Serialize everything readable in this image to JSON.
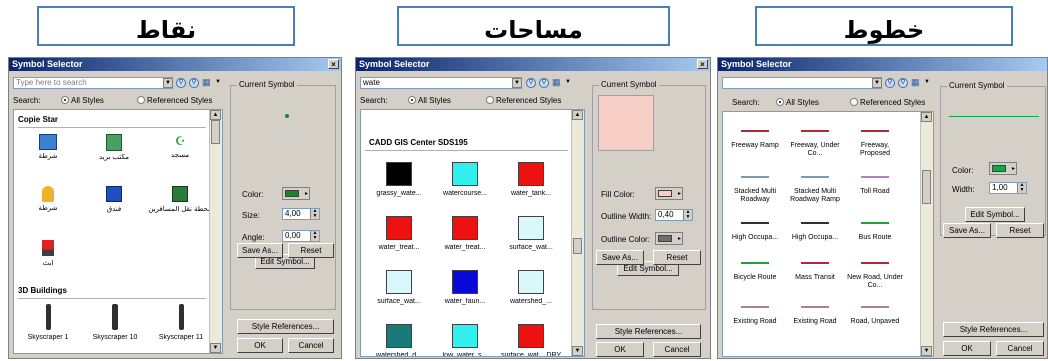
{
  "titles": {
    "points": "نقاط",
    "areas": "مساحات",
    "lines": "خطوط"
  },
  "common": {
    "window_title": "Symbol Selector",
    "close_glyph": "×",
    "search_label": "Search:",
    "all_styles": "All Styles",
    "referenced_styles": "Referenced Styles",
    "current_symbol": "Current Symbol",
    "edit_symbol": "Edit Symbol...",
    "save_as": "Save As...",
    "reset": "Reset",
    "style_references": "Style References...",
    "ok": "OK",
    "cancel": "Cancel",
    "dropdown_arrow": "▼",
    "scroll_up": "▲",
    "scroll_down": "▼"
  },
  "colors": {
    "point_color": "#128a1f",
    "line_color": "#10a64a",
    "fill_color": "#f7cfc6",
    "outline_color": "#6e6e6e",
    "titlebar": "#0a246a",
    "box_border": "#4a7ebb"
  },
  "points_dialog": {
    "search_placeholder": "Type here to search",
    "color_label": "Color:",
    "size_label": "Size:",
    "size_value": "4,00",
    "angle_label": "Angle:",
    "angle_value": "0,00",
    "category1": "Copie Star",
    "category2": "3D Buildings",
    "symbols": [
      {
        "label": "شرطة",
        "icon": "police-icon"
      },
      {
        "label": "مكتب بريد",
        "icon": "mailbox-icon"
      },
      {
        "label": "مسجد",
        "icon": "mosque-icon"
      },
      {
        "label": "شرطة",
        "icon": "police-figure-icon"
      },
      {
        "label": "فندق",
        "icon": "hotel-icon"
      },
      {
        "label": "محطة نقل المسافرين",
        "icon": "bus-station-icon"
      },
      {
        "label": "ابث",
        "icon": "broadcast-icon"
      }
    ],
    "buildings": [
      "Skyscraper 1",
      "Skyscraper 10",
      "Skyscraper 11"
    ]
  },
  "areas_dialog": {
    "search_value": "wate",
    "fill_color_label": "Fill Color:",
    "outline_width_label": "Outline Width:",
    "outline_width_value": "0,40",
    "outline_color_label": "Outline Color:",
    "category": "CADD GIS Center SDS195",
    "symbols": [
      {
        "label": "grassy_wate...",
        "color": "#000000"
      },
      {
        "label": "watercourse...",
        "color": "#33f0f0"
      },
      {
        "label": "water_tank...",
        "color": "#ee1111"
      },
      {
        "label": "water_treat...",
        "color": "#ee1111"
      },
      {
        "label": "water_treat...",
        "color": "#ee1111"
      },
      {
        "label": "surface_wat...",
        "color": "#d8f8fb"
      },
      {
        "label": "surface_wat...",
        "color": "#d8f8fb"
      },
      {
        "label": "water_faun...",
        "color": "#0a0ad8"
      },
      {
        "label": "watershed_...",
        "color": "#d8f8fb"
      },
      {
        "label": "watershed_d...",
        "color": "#1a7a78"
      },
      {
        "label": "low_water_s...",
        "color": "#33f0f0"
      },
      {
        "label": "surface_wat... DRY",
        "color": "#ee1111"
      }
    ]
  },
  "lines_dialog": {
    "search_value": "",
    "color_label": "Color:",
    "width_label": "Width:",
    "width_value": "1,00",
    "symbols": [
      {
        "label": "Freeway Ramp",
        "color": "#b0283c"
      },
      {
        "label": "Freeway, Under Co...",
        "color": "#b0283c"
      },
      {
        "label": "Freeway, Proposed",
        "color": "#b0283c"
      },
      {
        "label": "Stacked Multi Roadway",
        "color": "#7a9ab0"
      },
      {
        "label": "Stacked Multi Roadway Ramp",
        "color": "#7a9ab0"
      },
      {
        "label": "Toll Road",
        "color": "#b080c0"
      },
      {
        "label": "High Occupa...",
        "color": "#303030"
      },
      {
        "label": "High Occupa...",
        "color": "#303030"
      },
      {
        "label": "Bus Route",
        "color": "#20a040"
      },
      {
        "label": "Bicycle Route",
        "color": "#20a040"
      },
      {
        "label": "Mass Transit",
        "color": "#b0283c"
      },
      {
        "label": "New Road, Under Co...",
        "color": "#b0283c"
      },
      {
        "label": "Existing Road",
        "color": "#b08090"
      },
      {
        "label": "Existing Road",
        "color": "#b08090"
      },
      {
        "label": "Road, Unpaved",
        "color": "#b08090"
      }
    ]
  }
}
